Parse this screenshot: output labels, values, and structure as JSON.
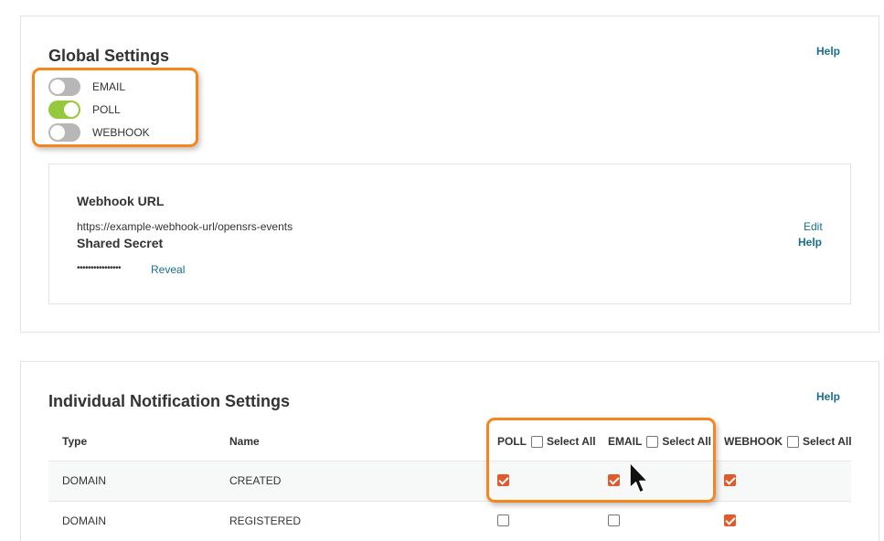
{
  "global": {
    "title": "Global Settings",
    "help": "Help",
    "toggles": [
      {
        "label": "EMAIL",
        "on": false
      },
      {
        "label": "POLL",
        "on": true
      },
      {
        "label": "WEBHOOK",
        "on": false
      }
    ]
  },
  "webhook": {
    "url_title": "Webhook URL",
    "url": "https://example-webhook-url/opensrs-events",
    "edit": "Edit",
    "secret_title": "Shared Secret",
    "secret_mask": "••••••••••••••••",
    "reveal": "Reveal",
    "help": "Help"
  },
  "individual": {
    "title": "Individual Notification Settings",
    "help": "Help",
    "columns": {
      "type": "Type",
      "name": "Name",
      "poll": "POLL",
      "email": "EMAIL",
      "webhook": "WEBHOOK",
      "select_all": "Select All"
    },
    "rows": [
      {
        "type": "DOMAIN",
        "name": "CREATED",
        "poll": true,
        "email": true,
        "webhook": true
      },
      {
        "type": "DOMAIN",
        "name": "REGISTERED",
        "poll": false,
        "email": false,
        "webhook": true
      }
    ]
  },
  "colors": {
    "accent_link": "#1a6e8f",
    "toggle_on": "#94c83d",
    "toggle_off": "#b7b7b7",
    "highlight": "#f5861f",
    "checkbox_checked": "#e05a2b"
  }
}
